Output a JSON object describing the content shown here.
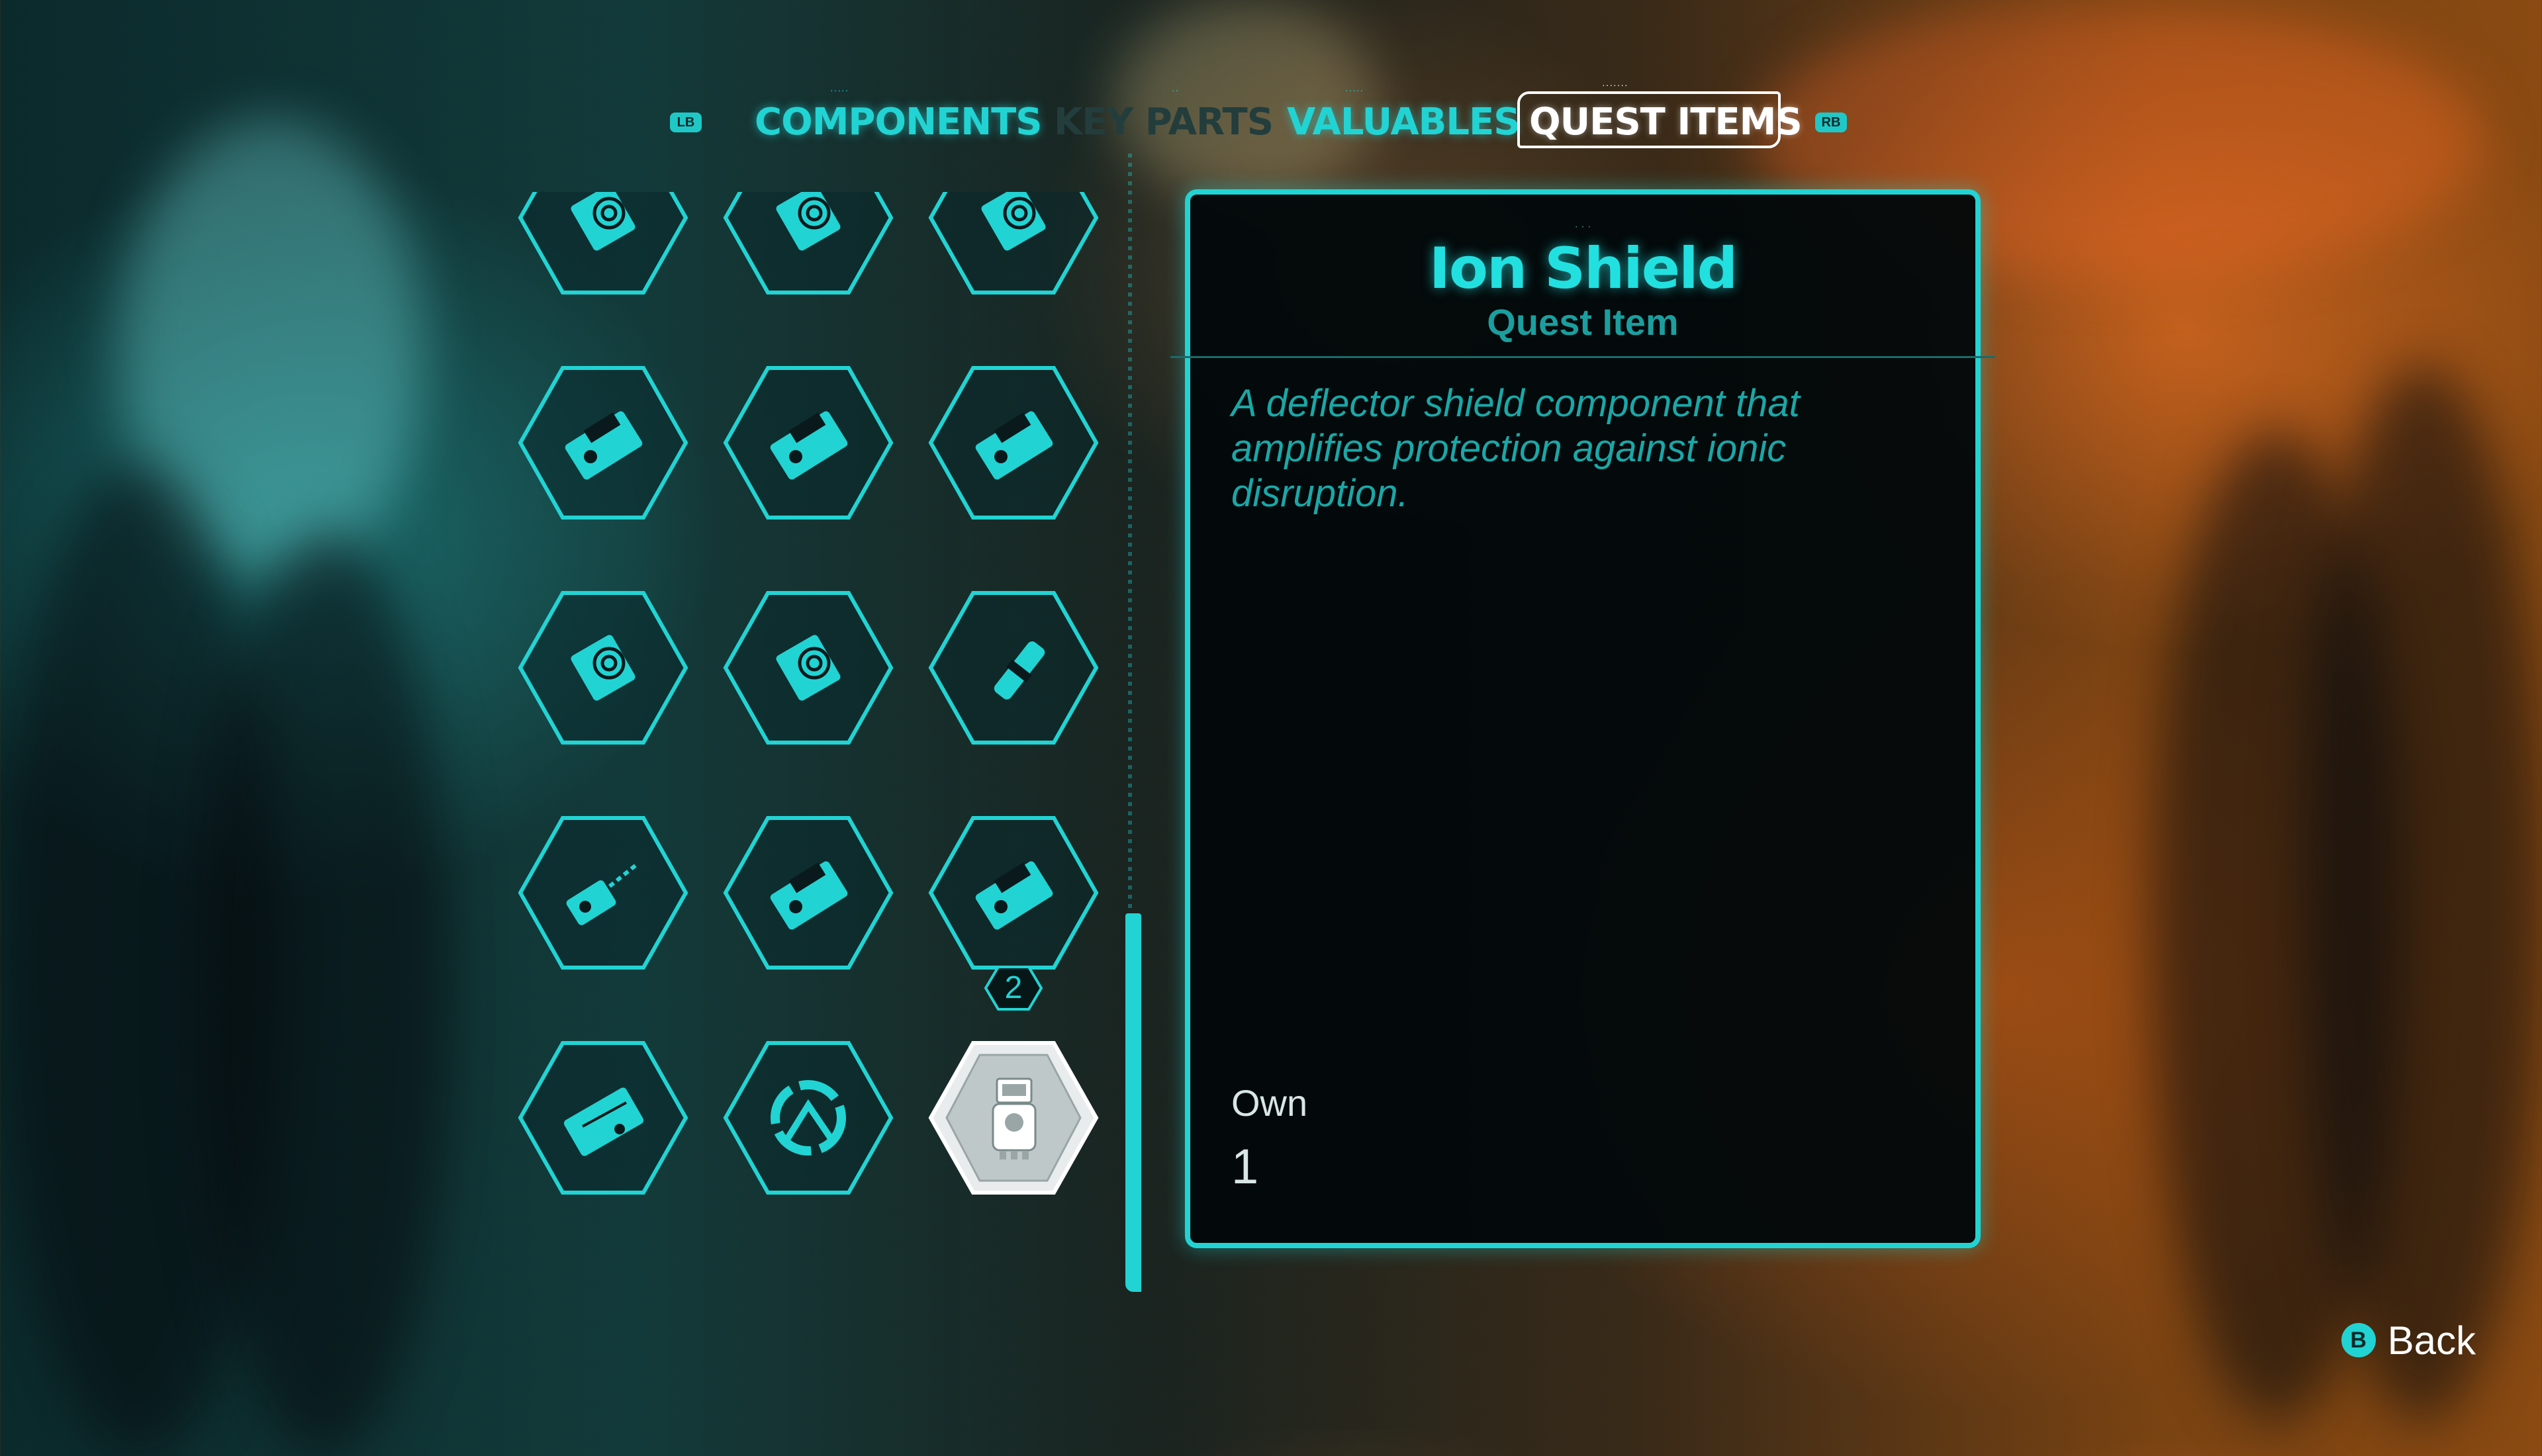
{
  "tabs": {
    "left_button": "LB",
    "right_button": "RB",
    "items": [
      {
        "label": "COMPONENTS",
        "state": "inactive"
      },
      {
        "label": "KEY PARTS",
        "state": "disabled"
      },
      {
        "label": "VALUABLES",
        "state": "inactive"
      },
      {
        "label": "QUEST ITEMS",
        "state": "active"
      }
    ]
  },
  "grid": {
    "items": [
      {
        "icon": "data-disc-icon"
      },
      {
        "icon": "data-disc-icon"
      },
      {
        "icon": "data-disc-icon"
      },
      {
        "icon": "keycard-icon"
      },
      {
        "icon": "keycard-icon"
      },
      {
        "icon": "keycard-icon"
      },
      {
        "icon": "data-disc-icon"
      },
      {
        "icon": "data-disc-icon"
      },
      {
        "icon": "power-cell-icon"
      },
      {
        "icon": "beam-device-icon"
      },
      {
        "icon": "keycard-icon"
      },
      {
        "icon": "keycard-icon",
        "count": "2"
      },
      {
        "icon": "chip-card-icon"
      },
      {
        "icon": "spiral-module-icon"
      },
      {
        "icon": "ion-shield-icon",
        "selected": true
      }
    ]
  },
  "detail": {
    "title": "Ion Shield",
    "subtitle": "Quest Item",
    "description": "A deflector shield component that amplifies protection against ionic disruption.",
    "own_label": "Own",
    "own_value": "1"
  },
  "footer": {
    "back_button": "B",
    "back_label": "Back"
  },
  "colors": {
    "accent": "#22d3d3",
    "panel_bg": "#02080a",
    "selected_item": "#e9ecec"
  }
}
